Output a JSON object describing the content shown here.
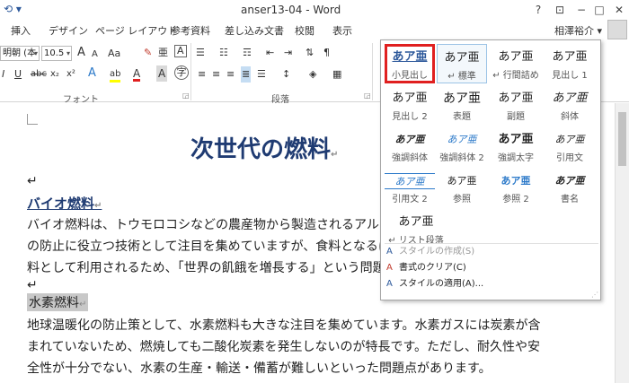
{
  "window": {
    "title": "anser13-04 - Word",
    "help": "?",
    "restore_ribbon": "⊡",
    "minimize": "−",
    "maximize": "□",
    "close": "✕"
  },
  "ribbon_tabs": [
    "挿入",
    "デザイン",
    "ページ レイアウト",
    "参考資料",
    "差し込み文書",
    "校閲",
    "表示"
  ],
  "user": {
    "name": "相澤裕介",
    "dropdown": "▾"
  },
  "font_group": {
    "font_name": "明朝 (本",
    "font_size": "10.5",
    "label": "フォント",
    "grow": "A",
    "shrink": "A",
    "case": "Aa",
    "clear": "✎",
    "phonetic": "亜",
    "border": "A",
    "italic": "I",
    "underline": "U",
    "strike": "abc",
    "subscript": "x₂",
    "superscript": "x²",
    "effects": "A",
    "highlight": "ab",
    "color": "A",
    "shade": "A",
    "enclose": "字"
  },
  "paragraph_group": {
    "label": "段落",
    "bullets": "☰",
    "numbering": "☷",
    "multilevel": "☶",
    "decrease_indent": "⇤",
    "increase_indent": "⇥",
    "sort": "⇅",
    "show_marks": "¶",
    "align_left": "≡",
    "align_center": "≡",
    "align_right": "≡",
    "justify": "≣",
    "distribute": "☰",
    "line_spacing": "↕",
    "shading": "◈",
    "borders": "▦"
  },
  "gallery": {
    "styles": [
      {
        "preview": "あア亜",
        "name": "小見出し"
      },
      {
        "preview": "あア亜",
        "name": "↵ 標準"
      },
      {
        "preview": "あア亜",
        "name": "↵ 行間詰め"
      },
      {
        "preview": "あア亜",
        "name": "見出し 1"
      },
      {
        "preview": "あア亜",
        "name": "見出し 2"
      },
      {
        "preview": "あア亜",
        "name": "表題"
      },
      {
        "preview": "あア亜",
        "name": "副題"
      },
      {
        "preview": "あア亜",
        "name": "斜体"
      },
      {
        "preview": "あア亜",
        "name": "強調斜体"
      },
      {
        "preview": "あア亜",
        "name": "強調斜体 2"
      },
      {
        "preview": "あア亜",
        "name": "強調太字"
      },
      {
        "preview": "あア亜",
        "name": "引用文"
      },
      {
        "preview": "あア亜",
        "name": "引用文 2"
      },
      {
        "preview": "あア亜",
        "name": "参照"
      },
      {
        "preview": "あア亜",
        "name": "参照 2"
      },
      {
        "preview": "あア亜",
        "name": "書名"
      },
      {
        "preview": "あア亜",
        "name": "↵ リスト段落"
      }
    ],
    "menu": [
      {
        "icon": "A",
        "label": "スタイルの作成(S)",
        "disabled": true
      },
      {
        "icon": "A",
        "label": "書式のクリア(C)",
        "disabled": false
      },
      {
        "icon": "A",
        "label": "スタイルの適用(A)...",
        "disabled": false
      }
    ]
  },
  "document": {
    "title": "次世代の燃料",
    "heading1": "バイオ燃料",
    "para1": [
      "バイオ燃料は、トウモロコシなどの農産物から製造されるアルコール",
      "の防止に役立つ技術として注目を集めていますが、食料となるはず",
      "料として利用されるため、「世界の飢餓を増長する」という問題が指"
    ],
    "heading2": "水素燃料",
    "para2": [
      "地球温暖化の防止策として、水素燃料も大きな注目を集めています。水素ガスには炭素が含",
      "まれていないため、燃焼しても二酸化炭素を発生しないのが特長です。ただし、耐久性や安",
      "全性が十分でない、水素の生産・輸送・備蓄が難しいといった問題点があります。"
    ],
    "para_mark": "↵"
  },
  "colors": {
    "accent": "#2b579a",
    "heading": "#1f3b72",
    "selection": "#e02020"
  }
}
